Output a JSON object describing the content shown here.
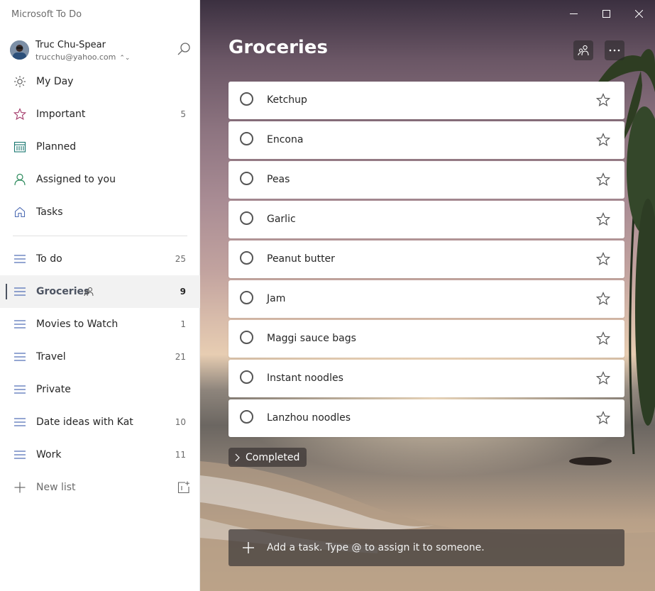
{
  "app": {
    "title": "Microsoft To Do"
  },
  "account": {
    "name": "Truc Chu-Spear",
    "email": "trucchu@yahoo.com"
  },
  "nav": {
    "smart_lists": [
      {
        "label": "My Day",
        "count": "",
        "icon": "sun-icon"
      },
      {
        "label": "Important",
        "count": "5",
        "icon": "star-icon"
      },
      {
        "label": "Planned",
        "count": "",
        "icon": "calendar-icon"
      },
      {
        "label": "Assigned to you",
        "count": "",
        "icon": "person-icon"
      },
      {
        "label": "Tasks",
        "count": "",
        "icon": "home-icon"
      }
    ],
    "lists": [
      {
        "label": "To do",
        "count": "25"
      },
      {
        "label": "Groceries",
        "count": "9",
        "selected": true,
        "shared": true
      },
      {
        "label": "Movies to Watch",
        "count": "1"
      },
      {
        "label": "Travel",
        "count": "21"
      },
      {
        "label": "Private",
        "count": ""
      },
      {
        "label": "Date ideas with Kat",
        "count": "10"
      },
      {
        "label": "Work",
        "count": "11"
      }
    ],
    "new_list_label": "New list"
  },
  "main": {
    "list_title": "Groceries",
    "tasks": [
      {
        "label": "Ketchup"
      },
      {
        "label": "Encona"
      },
      {
        "label": "Peas"
      },
      {
        "label": "Garlic"
      },
      {
        "label": "Peanut butter"
      },
      {
        "label": "Jam"
      },
      {
        "label": "Maggi sauce bags"
      },
      {
        "label": "Instant noodles"
      },
      {
        "label": "Lanzhou noodles"
      }
    ],
    "completed_label": "Completed",
    "add_task_placeholder": "Add a task. Type @ to assign it to someone."
  },
  "colors": {
    "accent_important": "#a33a6a",
    "accent_planned": "#17766f",
    "accent_assigned": "#2c8a5c",
    "list_icon": "#4d6bb3",
    "selected_bar": "#4d5462"
  }
}
